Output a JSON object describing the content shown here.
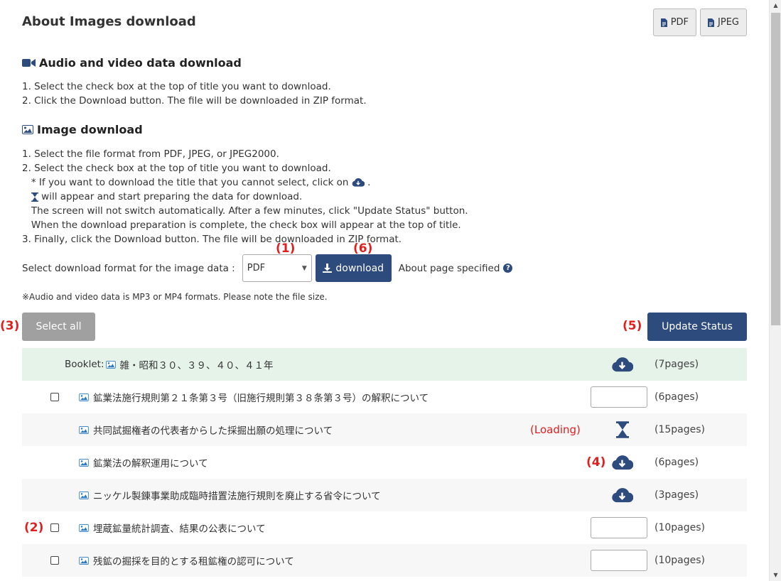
{
  "title": "About Images download",
  "top_buttons": {
    "pdf": "PDF",
    "jpeg": "JPEG"
  },
  "av_section": {
    "heading": "Audio and video data download",
    "steps": [
      "1. Select the check box at the top of title you want to download.",
      "2. Click the Download button. The file will be downloaded in ZIP format."
    ]
  },
  "image_section": {
    "heading": "Image download",
    "step1": "1. Select the file format from PDF, JPEG, or JPEG2000.",
    "step2": "2. Select the check box at the top of title you want to download.",
    "step2_note_a": "   * If you want to download the title that you cannot select, click on",
    "step2_note_a_end": ".",
    "step2_note_b": "will appear and start preparing the data for download.",
    "step2_note_c": "   The screen will not switch automatically. After a few minutes, click \"Update Status\" button.",
    "step2_note_d": "   When the download preparation is complete, the check box will appear at the top of title.",
    "step3": "3. Finally, click the Download button. The file will be downloaded in ZIP format."
  },
  "format_row": {
    "label": "Select download format for the image data :",
    "selected_format": "PDF",
    "download_label": "download",
    "page_specified": "About page specified"
  },
  "note": "※Audio and video data is MP3 or MP4 formats. Please note the file size.",
  "select_all_label": "Select all",
  "update_status_label": "Update Status",
  "markers": {
    "m1": "(1)",
    "m2": "(2)",
    "m3": "(3)",
    "m4": "(4)",
    "m5": "(5)",
    "m6": "(6)",
    "loading": "(Loading)"
  },
  "booklet": {
    "prefix": "Booklet:",
    "title": "雑・昭和３０、３９、４０、４１年",
    "pages": "(7pages)"
  },
  "items": [
    {
      "title": "鉱業法施行規則第２１条第３号（旧施行規則第３８条第３号）の解釈について",
      "pages": "(6pages)",
      "state": "checkbox"
    },
    {
      "title": "共同試掘権者の代表者からした採掘出願の処理について",
      "pages": "(15pages)",
      "state": "loading"
    },
    {
      "title": "鉱業法の解釈運用について",
      "pages": "(6pages)",
      "state": "cloud"
    },
    {
      "title": "ニッケル製錬事業助成臨時措置法施行規則を廃止する省令について",
      "pages": "(3pages)",
      "state": "cloud"
    },
    {
      "title": "埋蔵鉱量統計調査、結果の公表について",
      "pages": "(10pages)",
      "state": "checkbox"
    },
    {
      "title": "残鉱の掘採を目的とする租鉱権の認可について",
      "pages": "(10pages)",
      "state": "checkbox"
    }
  ],
  "colors": {
    "primary": "#2d4b7c",
    "marker": "#e0201f",
    "booklet_bg": "#e6f3e9",
    "select_all": "#a0a0a0"
  }
}
